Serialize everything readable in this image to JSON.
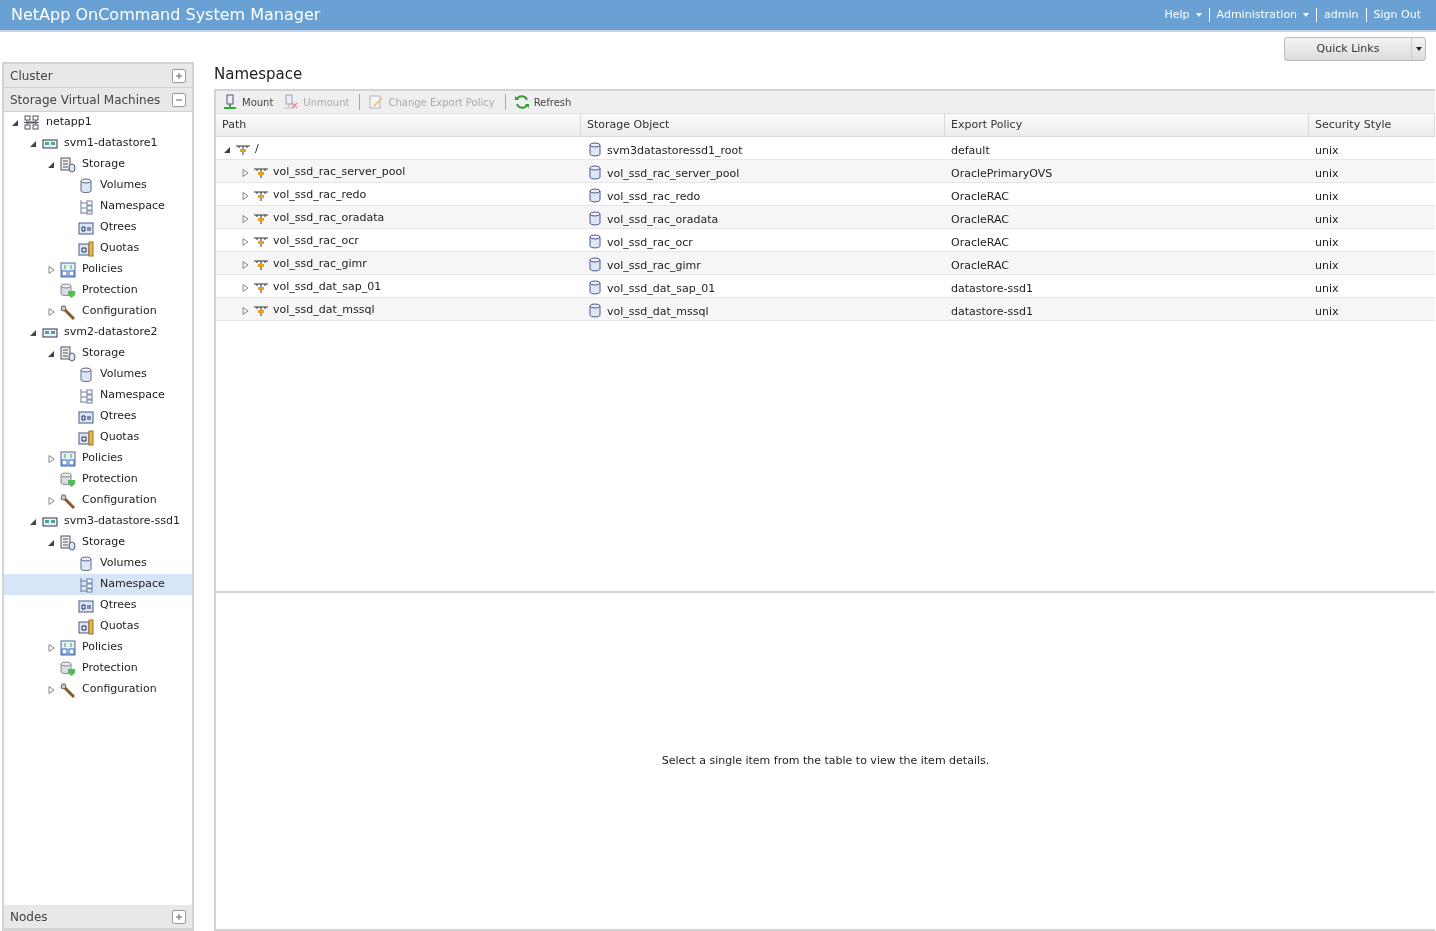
{
  "header": {
    "title": "NetApp OnCommand System Manager",
    "menu": [
      {
        "label": "Help",
        "kind": "dropdown"
      },
      {
        "label": "Administration",
        "kind": "dropdown"
      },
      {
        "label": "admin",
        "kind": "link"
      },
      {
        "label": "Sign Out",
        "kind": "link"
      }
    ]
  },
  "quick_links": "Quick Links",
  "sidebar": {
    "sections": [
      {
        "label": "Cluster",
        "expanded": false
      },
      {
        "label": "Storage Virtual Machines",
        "expanded": true
      }
    ],
    "tree": [
      {
        "label": "netapp1",
        "kind": "cluster",
        "expanded": true,
        "selected": false,
        "children": [
          {
            "label": "svm1-datastore1",
            "kind": "svm",
            "expanded": true,
            "selected": false,
            "children": [
              {
                "label": "Storage",
                "kind": "storage",
                "expanded": true,
                "selected": false,
                "children": [
                  {
                    "label": "Volumes",
                    "kind": "volume",
                    "selected": false
                  },
                  {
                    "label": "Namespace",
                    "kind": "namespace",
                    "selected": false
                  },
                  {
                    "label": "Qtrees",
                    "kind": "qtree",
                    "selected": false
                  },
                  {
                    "label": "Quotas",
                    "kind": "quota",
                    "selected": false
                  }
                ]
              },
              {
                "label": "Policies",
                "kind": "policy",
                "expanded": false,
                "selected": false
              },
              {
                "label": "Protection",
                "kind": "protection",
                "selected": false
              },
              {
                "label": "Configuration",
                "kind": "config",
                "expanded": false,
                "selected": false
              }
            ]
          },
          {
            "label": "svm2-datastore2",
            "kind": "svm",
            "expanded": true,
            "selected": false,
            "children": [
              {
                "label": "Storage",
                "kind": "storage",
                "expanded": true,
                "selected": false,
                "children": [
                  {
                    "label": "Volumes",
                    "kind": "volume",
                    "selected": false
                  },
                  {
                    "label": "Namespace",
                    "kind": "namespace",
                    "selected": false
                  },
                  {
                    "label": "Qtrees",
                    "kind": "qtree",
                    "selected": false
                  },
                  {
                    "label": "Quotas",
                    "kind": "quota",
                    "selected": false
                  }
                ]
              },
              {
                "label": "Policies",
                "kind": "policy",
                "expanded": false,
                "selected": false
              },
              {
                "label": "Protection",
                "kind": "protection",
                "selected": false
              },
              {
                "label": "Configuration",
                "kind": "config",
                "expanded": false,
                "selected": false
              }
            ]
          },
          {
            "label": "svm3-datastore-ssd1",
            "kind": "svm",
            "expanded": true,
            "selected": false,
            "children": [
              {
                "label": "Storage",
                "kind": "storage",
                "expanded": true,
                "selected": false,
                "children": [
                  {
                    "label": "Volumes",
                    "kind": "volume",
                    "selected": false
                  },
                  {
                    "label": "Namespace",
                    "kind": "namespace",
                    "selected": true
                  },
                  {
                    "label": "Qtrees",
                    "kind": "qtree",
                    "selected": false
                  },
                  {
                    "label": "Quotas",
                    "kind": "quota",
                    "selected": false
                  }
                ]
              },
              {
                "label": "Policies",
                "kind": "policy",
                "expanded": false,
                "selected": false
              },
              {
                "label": "Protection",
                "kind": "protection",
                "selected": false
              },
              {
                "label": "Configuration",
                "kind": "config",
                "expanded": false,
                "selected": false
              }
            ]
          }
        ]
      }
    ],
    "footer_section": {
      "label": "Nodes",
      "expanded": false
    }
  },
  "page_title": "Namespace",
  "toolbar": [
    {
      "label": "Mount",
      "kind": "mount",
      "disabled": false,
      "separator": false
    },
    {
      "label": "Unmount",
      "kind": "unmount",
      "disabled": true,
      "separator": false
    },
    {
      "label": "Change Export Policy",
      "kind": "edit",
      "disabled": true,
      "separator": true
    },
    {
      "label": "Refresh",
      "kind": "refresh",
      "disabled": false,
      "separator": true
    }
  ],
  "table": {
    "columns": [
      "Path",
      "Storage Object",
      "Export Policy",
      "Security Style"
    ],
    "rows": [
      {
        "path": "/",
        "expanded": true,
        "storage_object": "svm3datastoressd1_root",
        "export_policy": "default",
        "security_style": "unix",
        "children": [
          {
            "path": "vol_ssd_rac_server_pool",
            "expanded": false,
            "storage_object": "vol_ssd_rac_server_pool",
            "export_policy": "OraclePrimaryOVS",
            "security_style": "unix"
          },
          {
            "path": "vol_ssd_rac_redo",
            "expanded": false,
            "storage_object": "vol_ssd_rac_redo",
            "export_policy": "OracleRAC",
            "security_style": "unix"
          },
          {
            "path": "vol_ssd_rac_oradata",
            "expanded": false,
            "storage_object": "vol_ssd_rac_oradata",
            "export_policy": "OracleRAC",
            "security_style": "unix"
          },
          {
            "path": "vol_ssd_rac_ocr",
            "expanded": false,
            "storage_object": "vol_ssd_rac_ocr",
            "export_policy": "OracleRAC",
            "security_style": "unix"
          },
          {
            "path": "vol_ssd_rac_gimr",
            "expanded": false,
            "storage_object": "vol_ssd_rac_gimr",
            "export_policy": "OracleRAC",
            "security_style": "unix"
          },
          {
            "path": "vol_ssd_dat_sap_01",
            "expanded": false,
            "storage_object": "vol_ssd_dat_sap_01",
            "export_policy": "datastore-ssd1",
            "security_style": "unix"
          },
          {
            "path": "vol_ssd_dat_mssql",
            "expanded": false,
            "storage_object": "vol_ssd_dat_mssql",
            "export_policy": "datastore-ssd1",
            "security_style": "unix"
          }
        ]
      }
    ]
  },
  "details_message": "Select a single item from the table to view the item details."
}
